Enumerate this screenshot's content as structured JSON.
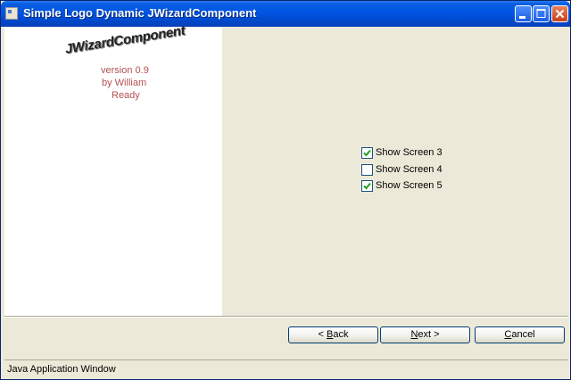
{
  "window": {
    "title": "Simple Logo Dynamic JWizardComponent",
    "controls": {
      "minimize": "minimize-icon",
      "maximize": "maximize-icon",
      "close": "close-icon"
    }
  },
  "logo": {
    "title": "JWizardComponent",
    "version": "version 0.9",
    "author": "by William",
    "status": "Ready"
  },
  "options": [
    {
      "label": "Show Screen 3",
      "checked": true
    },
    {
      "label": "Show Screen 4",
      "checked": false
    },
    {
      "label": "Show Screen 5",
      "checked": true
    }
  ],
  "buttons": {
    "back": {
      "prefix": "< ",
      "mnemonic": "B",
      "rest": "ack"
    },
    "next": {
      "mnemonic": "N",
      "rest": "ext >"
    },
    "cancel": {
      "mnemonic": "C",
      "rest": "ancel"
    }
  },
  "statusbar": {
    "text": "Java Application Window"
  },
  "colors": {
    "titlebar": "#0054e3",
    "accent_text": "#b35050",
    "background": "#ece9d8"
  }
}
